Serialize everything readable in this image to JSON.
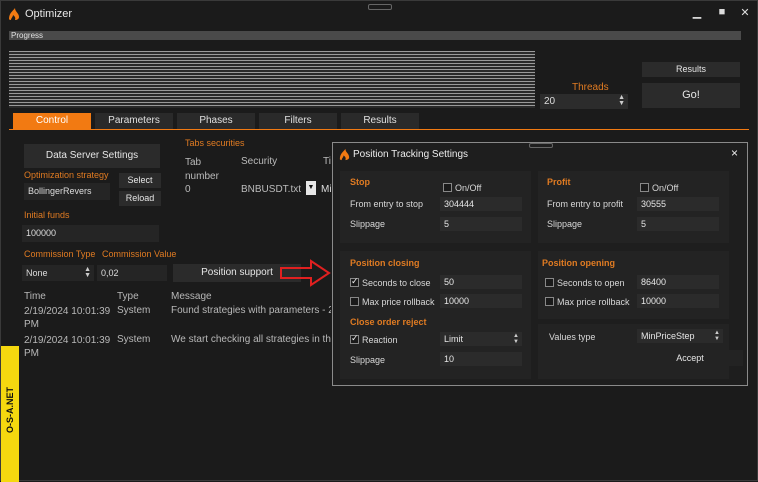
{
  "window": {
    "title": "Optimizer"
  },
  "progress": {
    "label": "Progress"
  },
  "threads": {
    "label": "Threads",
    "value": "20"
  },
  "buttons": {
    "results": "Results",
    "go": "Go!"
  },
  "tabs": [
    "Control",
    "Parameters",
    "Phases",
    "Filters",
    "Results"
  ],
  "control": {
    "data_server_settings": "Data Server Settings",
    "optimization_strategy_label": "Optimization strategy",
    "strategy_value": "BollingerRevers",
    "select": "Select",
    "reload": "Reload",
    "initial_funds_label": "Initial funds",
    "initial_funds_value": "100000",
    "commission_type_label": "Commission Type",
    "commission_value_label": "Commission Value",
    "commission_type_value": "None",
    "commission_value": "0,02",
    "position_support": "Position support",
    "tabs_securities_label": "Tabs securities",
    "sec_headers": [
      "Tab number",
      "Security",
      "Ti"
    ],
    "sec_row": {
      "tab": "0",
      "security": "BNBUSDT.txt",
      "extra": "Mi"
    }
  },
  "log": {
    "headers": [
      "Time",
      "Type",
      "Message"
    ],
    "rows": [
      {
        "time": "2/19/2024 10:01:39 PM",
        "type": "System",
        "message": "Found strategies with parameters - 2"
      },
      {
        "time": "2/19/2024 10:01:39 PM",
        "type": "System",
        "message": "We start checking all strategies in the"
      }
    ]
  },
  "side_brand": "O-S-A.NET",
  "dialog": {
    "title": "Position Tracking Settings",
    "stop": {
      "title": "Stop",
      "onoff": "On/Off",
      "from_entry_label": "From entry to stop",
      "from_entry_value": "304444",
      "slippage_label": "Slippage",
      "slippage_value": "5"
    },
    "profit": {
      "title": "Profit",
      "onoff": "On/Off",
      "from_entry_label": "From entry to profit",
      "from_entry_value": "30555",
      "slippage_label": "Slippage",
      "slippage_value": "5"
    },
    "closing": {
      "title": "Position closing",
      "seconds_label": "Seconds to close",
      "seconds_value": "50",
      "rollback_label": "Max price rollback",
      "rollback_value": "10000"
    },
    "opening": {
      "title": "Position opening",
      "seconds_label": "Seconds to open",
      "seconds_value": "86400",
      "rollback_label": "Max price rollback",
      "rollback_value": "10000"
    },
    "reject": {
      "title": "Close order reject",
      "reaction_label": "Reaction",
      "reaction_value": "Limit",
      "slippage_label": "Slippage",
      "slippage_value": "10"
    },
    "values_type_label": "Values type",
    "values_type_value": "MinPriceStep",
    "accept": "Accept"
  },
  "colors": {
    "accent": "#f27a12",
    "brand_strip": "#f5d80f",
    "arrow": "#e02020"
  },
  "icons": {
    "logo": "flame-logo-icon",
    "close": "close-icon"
  }
}
